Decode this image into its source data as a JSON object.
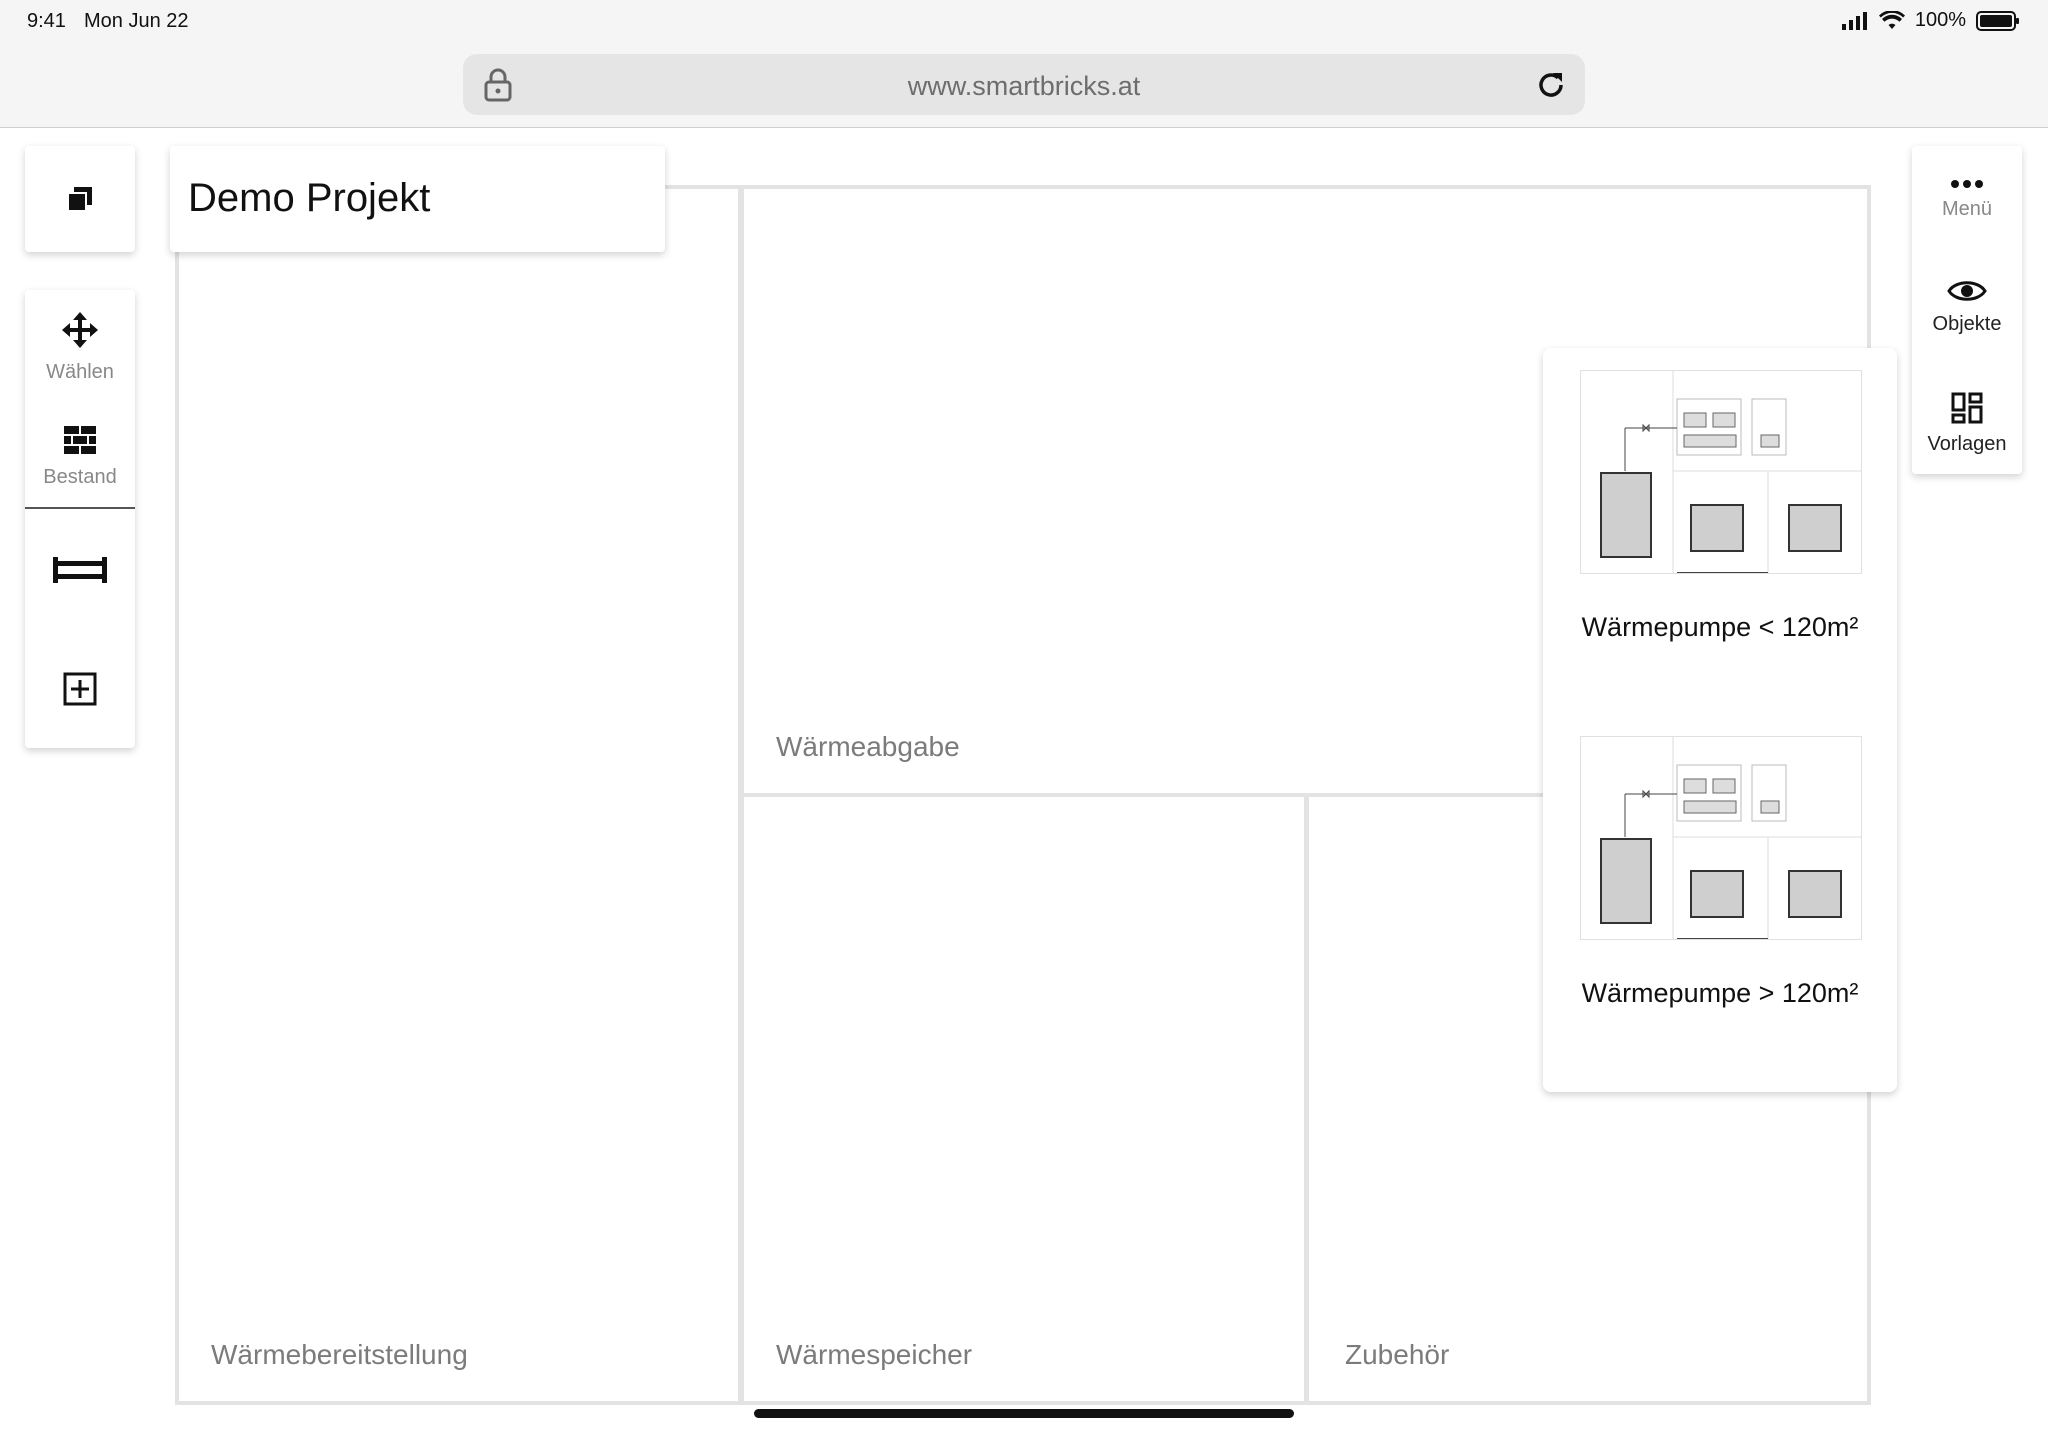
{
  "status_bar": {
    "time": "9:41",
    "date": "Mon Jun 22",
    "battery": "100%"
  },
  "browser": {
    "url": "www.smartbricks.at"
  },
  "project": {
    "title": "Demo Projekt"
  },
  "toolbar_left": {
    "items": [
      {
        "label": "Wählen",
        "icon": "move-arrows-icon"
      },
      {
        "label": "Bestand",
        "icon": "brick-wall-icon"
      },
      {
        "label": "",
        "icon": "dimension-icon"
      },
      {
        "label": "",
        "icon": "add-box-icon"
      }
    ]
  },
  "toolbar_right": {
    "items": [
      {
        "label": "Menü",
        "icon": "more-horizontal-icon"
      },
      {
        "label": "Objekte",
        "icon": "eye-icon"
      },
      {
        "label": "Vorlagen",
        "icon": "dashboard-icon"
      }
    ]
  },
  "zones": {
    "waermebereitstellung": "Wärmebereitstellung",
    "waermeabgabe": "Wärmeabgabe",
    "waermespeicher": "Wärmespeicher",
    "zubehoer": "Zubehör"
  },
  "templates": [
    {
      "title": "Wärmepumpe < 120m²"
    },
    {
      "title": "Wärmepumpe > 120m²"
    }
  ],
  "colors": {
    "zone_border": "#e3e3e3",
    "label_gray": "#7b7b7b"
  }
}
